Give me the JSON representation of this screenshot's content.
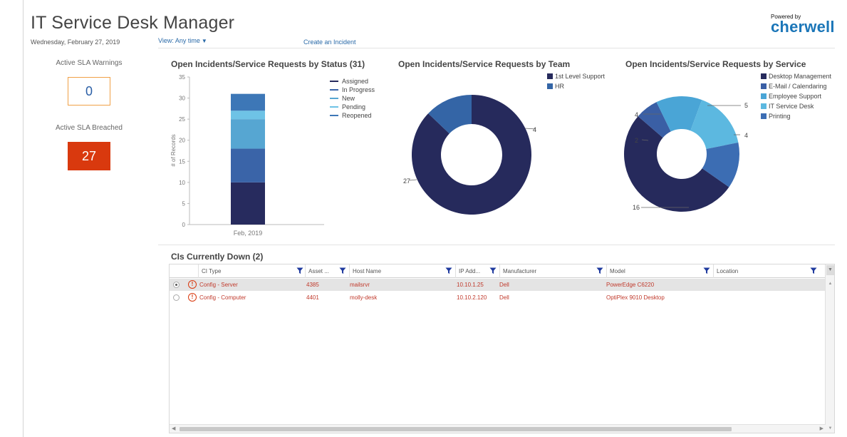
{
  "header": {
    "title": "IT Service Desk Manager",
    "date": "Wednesday, February 27, 2019",
    "view_filter": "View: Any time",
    "create_link": "Create an Incident",
    "logo_powered": "Powered by",
    "logo_brand": "cherwell"
  },
  "sla": {
    "warnings_label": "Active SLA Warnings",
    "warnings_value": "0",
    "breached_label": "Active SLA Breached",
    "breached_value": "27"
  },
  "charts": {
    "status_title": "Open Incidents/Service Requests by Status (31)",
    "team_title": "Open Incidents/Service Requests by Team",
    "service_title": "Open Incidents/Service Requests by Service"
  },
  "chart_data": [
    {
      "type": "bar",
      "stacked": true,
      "title": "Open Incidents/Service Requests by Status (31)",
      "categories": [
        "Feb, 2019"
      ],
      "ylabel": "# of Records",
      "ylim": [
        0,
        35
      ],
      "yticks": [
        0,
        5,
        10,
        15,
        20,
        25,
        30,
        35
      ],
      "legend_position": "top-right",
      "series": [
        {
          "name": "Assigned",
          "values": [
            10
          ],
          "color": "#272b5e"
        },
        {
          "name": "In Progress",
          "values": [
            8
          ],
          "color": "#3a64a8"
        },
        {
          "name": "New",
          "values": [
            7
          ],
          "color": "#56a6d2"
        },
        {
          "name": "Pending",
          "values": [
            2
          ],
          "color": "#6ec3e6"
        },
        {
          "name": "Reopened",
          "values": [
            4
          ],
          "color": "#3d77b7"
        }
      ]
    },
    {
      "type": "pie",
      "donut": true,
      "title": "Open Incidents/Service Requests by Team",
      "legend_position": "top-right",
      "slices": [
        {
          "name": "1st Level Support",
          "value": 27,
          "label": "27",
          "color": "#262a5c"
        },
        {
          "name": "HR",
          "value": 4,
          "label": "4",
          "color": "#3465a6"
        }
      ]
    },
    {
      "type": "pie",
      "donut": true,
      "title": "Open Incidents/Service Requests by Service",
      "legend_position": "top-right",
      "slices": [
        {
          "name": "Desktop Management",
          "value": 16,
          "label": "16",
          "color": "#262a5c"
        },
        {
          "name": "E-Mail / Calendaring",
          "value": 2,
          "label": "2",
          "color": "#3a5fa5"
        },
        {
          "name": "Employee Support",
          "value": 4,
          "label": "4",
          "color": "#4aa5d6"
        },
        {
          "name": "IT Service Desk",
          "value": 5,
          "label": "5",
          "color": "#5cb8e0"
        },
        {
          "name": "Printing",
          "value": 4,
          "label": "4",
          "color": "#3c6db3"
        }
      ]
    }
  ],
  "ci_grid": {
    "title": "CIs Currently Down (2)",
    "columns": [
      "CI Type",
      "Asset ...",
      "Host Name",
      "IP Add...",
      "Manufacturer",
      "Model",
      "Location"
    ],
    "rows": [
      {
        "ci_type": "Config - Server",
        "asset": "4385",
        "host": "mailsrvr",
        "ip": "10.10.1.25",
        "manufacturer": "Dell",
        "model": "PowerEdge C6220",
        "location": "",
        "selected": true
      },
      {
        "ci_type": "Config - Computer",
        "asset": "4401",
        "host": "molly-desk",
        "ip": "10.10.2.120",
        "manufacturer": "Dell",
        "model": "OptiPlex 9010 Desktop",
        "location": "",
        "selected": false
      }
    ]
  },
  "colors": {
    "accent_link": "#2a6aa8",
    "warning_border": "#f0a046",
    "breach_bg": "#d9390e",
    "row_text": "#c0392b",
    "filter_icon": "#1f3a9e"
  },
  "icons": {
    "filter": "filter-funnel-icon",
    "alert": "exclamation-circle-icon",
    "caret": "caret-down-icon"
  }
}
